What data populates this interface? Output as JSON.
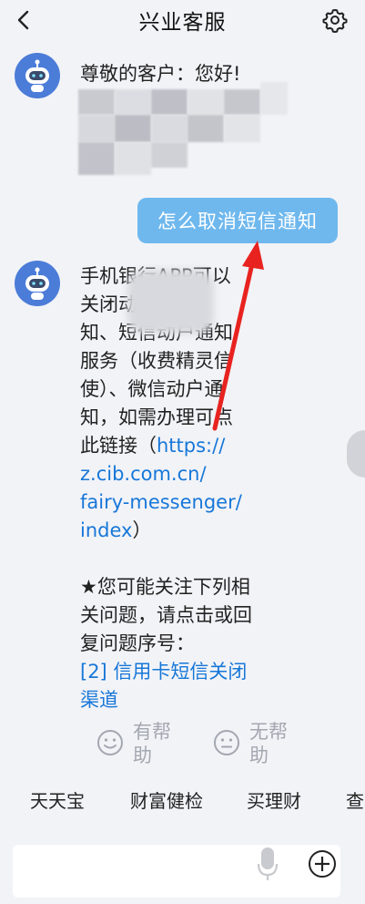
{
  "header": {
    "title": "兴业客服"
  },
  "messages": {
    "greeting": "尊敬的客户：您好!",
    "user_question": "怎么取消短信通知",
    "answer_lines": [
      "手机银行APP可以",
      "关闭动户通",
      "知、短信动户通知",
      "服务（收费精灵信",
      "使）、微信动户通",
      "知，如需办理可点"
    ],
    "answer_link_prefix": "此链接（",
    "answer_link_lines": [
      "https://",
      "z.cib.com.cn/",
      "fairy-messenger/",
      "index"
    ],
    "answer_link_suffix": "）",
    "related_lines": [
      "★您可能关注下列相",
      "关问题，请点击或回",
      "复问题序号："
    ],
    "related_link_lines": [
      "[2] 信用卡短信关闭",
      "渠道"
    ]
  },
  "feedback": {
    "helpful_lines": [
      "有帮",
      "助"
    ],
    "unhelpful_lines": [
      "无帮",
      "助"
    ]
  },
  "quick_replies": [
    "天天宝",
    "财富健检",
    "买理财",
    "查"
  ],
  "colors": {
    "accent_blue": "#1777d8",
    "bubble_blue": "#6fb8ee",
    "avatar_blue": "#4b7cd8",
    "arrow_red": "#e8231f"
  }
}
